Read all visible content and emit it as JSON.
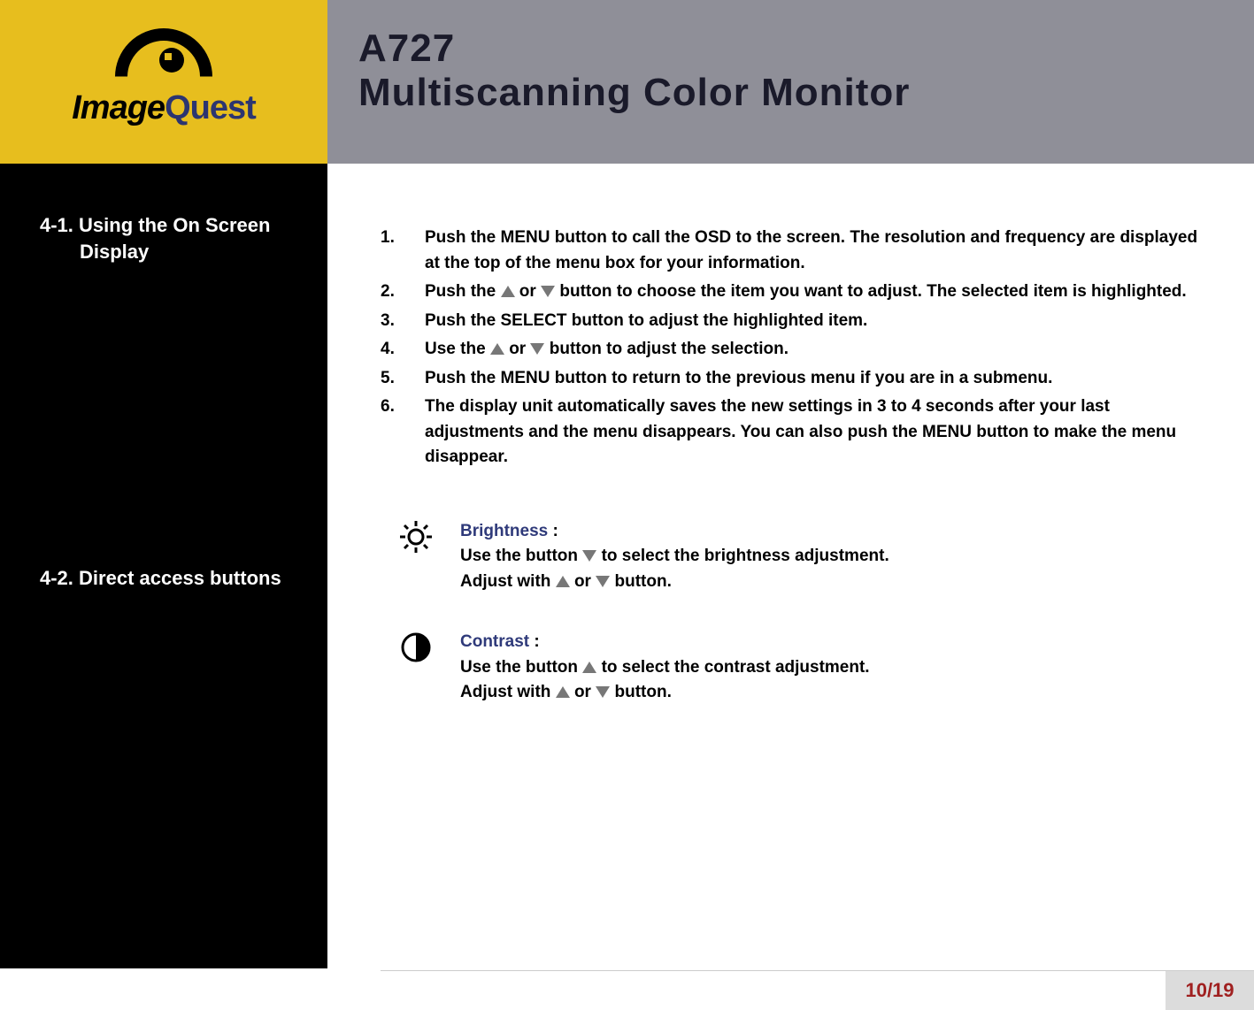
{
  "logo": {
    "part1": "Image",
    "part2": "Quest"
  },
  "title": {
    "model": "A727",
    "subtitle": "Multiscanning Color Monitor"
  },
  "sidebar": {
    "sec1_num": "4-1.",
    "sec1_line1": "Using the On Screen",
    "sec1_line2": "Display",
    "sec2_num": "4-2.",
    "sec2_text": "Direct access buttons"
  },
  "steps": [
    {
      "n": "1.",
      "a": "Push the MENU button to call the OSD to the screen. The resolution and frequency are displayed at the top of the menu box for your information."
    },
    {
      "n": "2.",
      "a": "Push the ",
      "m": " or ",
      "b": " button to choose the item you want to adjust. The  selected item is highlighted."
    },
    {
      "n": "3.",
      "a": "Push the SELECT button to adjust the highlighted item."
    },
    {
      "n": "4.",
      "a": "Use the ",
      "m": "  or  ",
      "b": " button to adjust the selection."
    },
    {
      "n": "5.",
      "a": "Push the MENU button to return to the previous menu if you are in a submenu."
    },
    {
      "n": "6.",
      "a": "The display unit automatically saves the new settings in 3 to 4 seconds after your last adjustments and the menu disappears. You can also push the MENU button to make the menu disappear."
    }
  ],
  "direct": {
    "brightness": {
      "title": "Brightness",
      "colon": "   :",
      "l1a": "Use the button ",
      "l1b": " to select the brightness adjustment.",
      "l2a": "Adjust with  ",
      "l2m": " or ",
      "l2b": " button."
    },
    "contrast": {
      "title": "Contrast",
      "colon": "   :",
      "l1a": "Use the button  ",
      "l1b": " to select the contrast adjustment.",
      "l2a": "Adjust with ",
      "l2m": " or  ",
      "l2b": " button."
    }
  },
  "page": "10/19"
}
